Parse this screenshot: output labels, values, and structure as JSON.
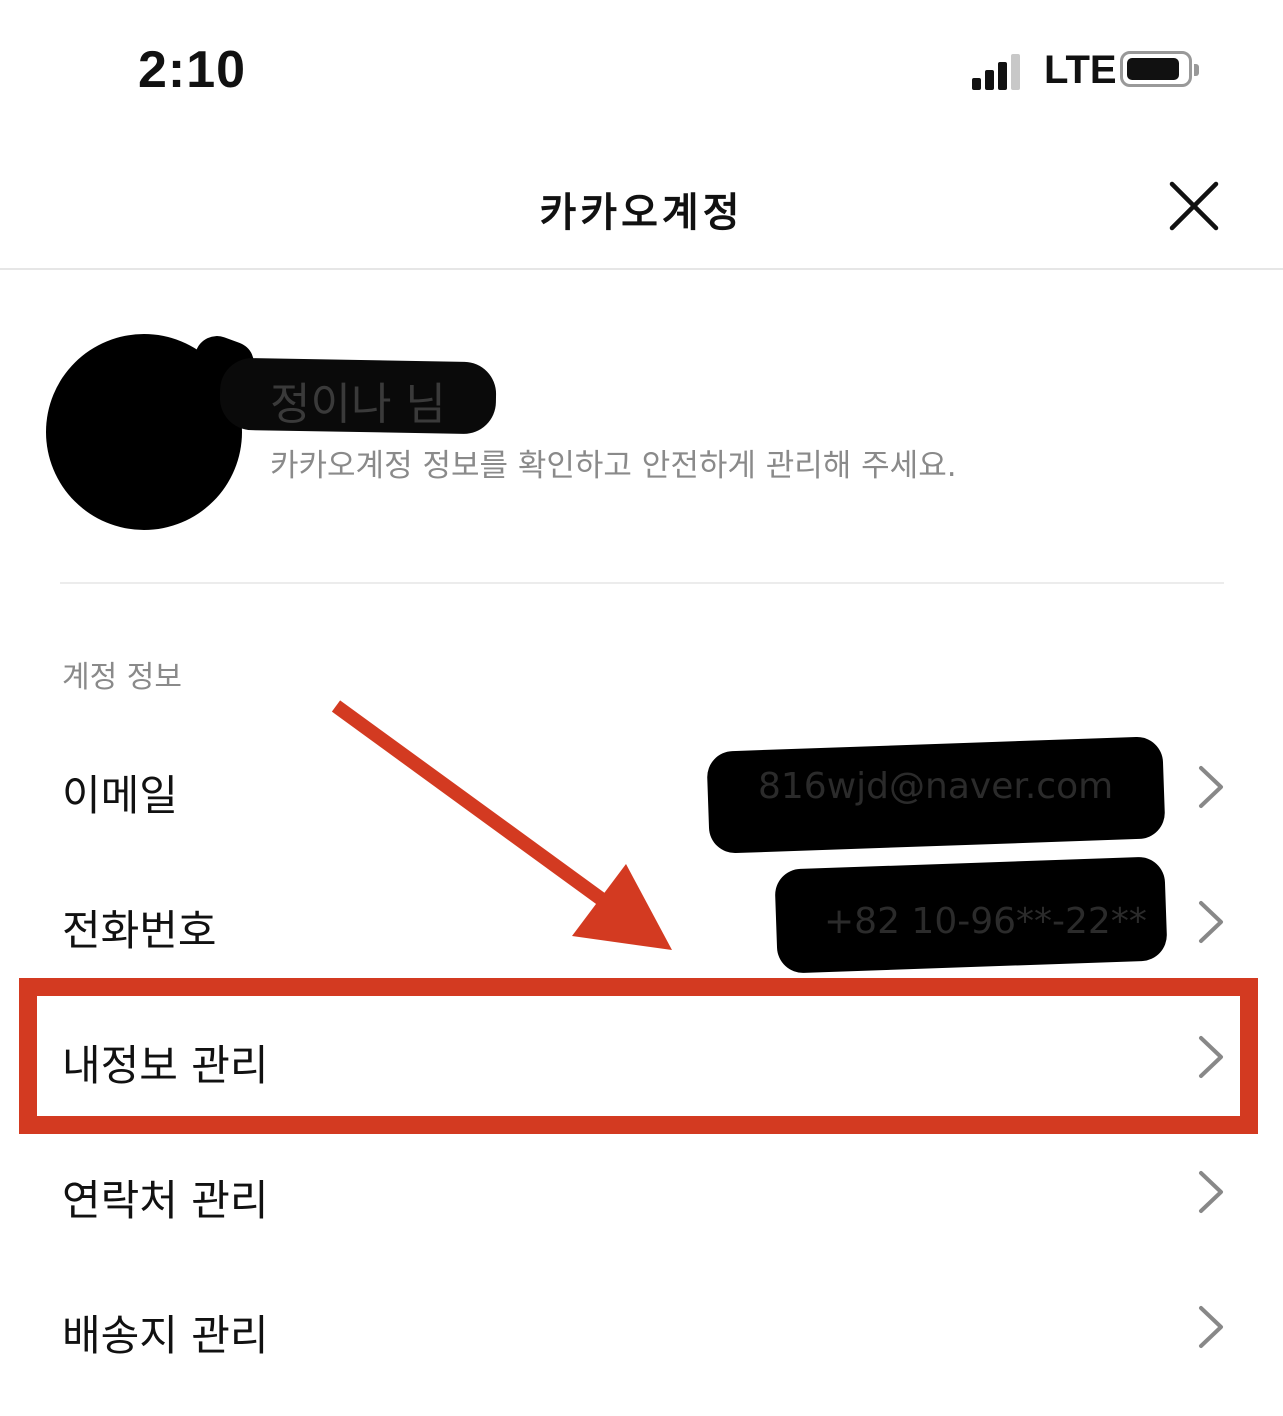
{
  "status_bar": {
    "time": "2:10",
    "network": "LTE"
  },
  "header": {
    "title": "카카오계정",
    "close_icon": "close-icon"
  },
  "profile": {
    "name": "정이나 님",
    "subtitle": "카카오계정 정보를 확인하고 안전하게 관리해 주세요."
  },
  "section": {
    "label": "계정 정보",
    "items": [
      {
        "label": "이메일",
        "value": "816wjd@naver.com"
      },
      {
        "label": "전화번호",
        "value": "+82 10-96**-22**"
      },
      {
        "label": "내정보 관리",
        "value": ""
      },
      {
        "label": "연락처 관리",
        "value": ""
      },
      {
        "label": "배송지 관리",
        "value": ""
      }
    ]
  },
  "annotation": {
    "highlight_color": "#d33a21",
    "highlighted_item": "내정보 관리"
  },
  "icons": {
    "row_chevron": "chevron-right-icon"
  }
}
